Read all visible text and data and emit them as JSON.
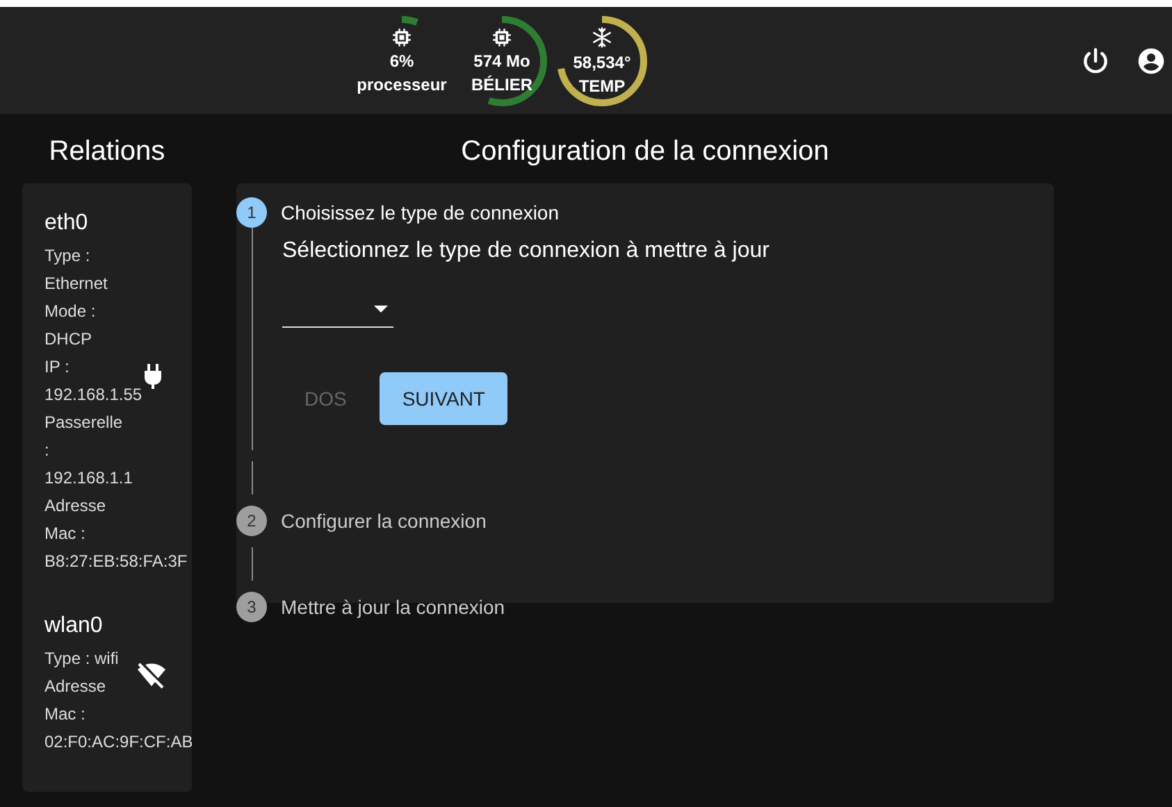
{
  "gauges": [
    {
      "kind": "cpu",
      "value": "6%",
      "label": "processeur",
      "level": 0.06,
      "color": "#2e7d32"
    },
    {
      "kind": "cpu",
      "value": "574 Mo",
      "label": "BÉLIER",
      "level": 0.55,
      "color": "#2e7d32"
    },
    {
      "kind": "snow",
      "value": "58,534°",
      "label": "TEMP",
      "level": 0.72,
      "color": "#c0b050"
    }
  ],
  "sidebar": {
    "title": "Relations",
    "interfaces": [
      {
        "name": "eth0",
        "connected": true,
        "lines": [
          "Type :",
          "Ethernet",
          "Mode :",
          "DHCP",
          "IP :",
          "192.168.1.55",
          "Passerelle",
          ":",
          "192.168.1.1",
          "Adresse",
          "Mac :",
          "B8:27:EB:58:FA:3F"
        ]
      },
      {
        "name": "wlan0",
        "connected": false,
        "lines": [
          "Type : wifi",
          "Adresse",
          "Mac :",
          "02:F0:AC:9F:CF:AB"
        ]
      }
    ]
  },
  "main": {
    "title": "Configuration de la connexion",
    "steps": [
      {
        "number": "1",
        "label": "Choisissez le type de connexion",
        "selected": true
      },
      {
        "number": "2",
        "label": "Configurer la connexion",
        "selected": false
      },
      {
        "number": "3",
        "label": "Mettre à jour la connexion",
        "selected": false
      }
    ],
    "prompt": "Sélectionnez le type de connexion à mettre à jour",
    "buttons": [
      {
        "label": "DOS",
        "disabled": true
      },
      {
        "label": "SUIVANT",
        "disabled": false
      }
    ]
  }
}
